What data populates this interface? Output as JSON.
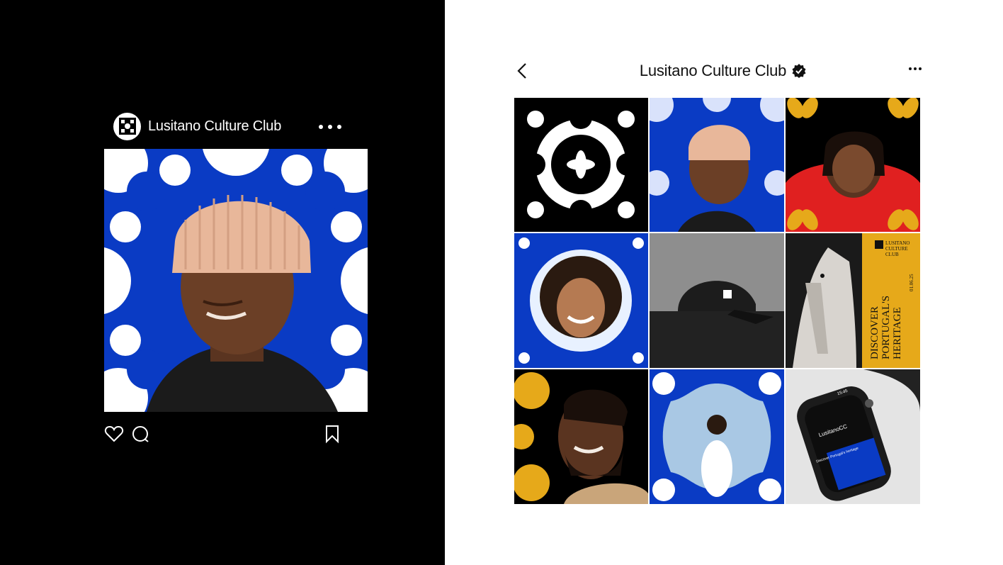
{
  "post": {
    "username": "Lusitano Culture Club",
    "avatar_icon": "lusitano-logo-icon",
    "actions": {
      "like_icon": "heart-icon",
      "comment_icon": "comment-icon",
      "save_icon": "bookmark-icon"
    }
  },
  "profile": {
    "name": "Lusitano Culture Club",
    "back_icon": "chevron-left-icon",
    "verified_icon": "verified-badge-icon",
    "more_icon": "more-icon"
  },
  "grid": {
    "tile_6": {
      "brand_line1": "LUSITANO",
      "brand_line2": "CULTURE",
      "brand_line3": "CLUB",
      "date": "01.06.25",
      "headline_line1": "DISCOVER",
      "headline_line2": "PORTUGAL'S",
      "headline_line3": "HERITAGE"
    },
    "tile_9": {
      "watch_time": "15:45",
      "watch_app": "LusitanoCC",
      "watch_caption": "Discover Portugal's heritage"
    }
  },
  "colors": {
    "azulejo_blue": "#0a3bc4",
    "gold": "#e6a91a",
    "black": "#000000",
    "white": "#ffffff"
  }
}
